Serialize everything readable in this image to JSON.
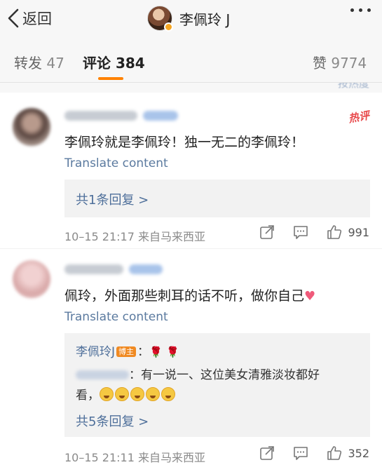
{
  "nav": {
    "back_label": "返回",
    "title": "李佩玲 J"
  },
  "tabs": [
    {
      "label": "转发",
      "count": "47"
    },
    {
      "label": "评论",
      "count": "384"
    },
    {
      "label": "赞",
      "count": "9774"
    }
  ],
  "comments": [
    {
      "hot_badge": "热评",
      "text": "李佩玲就是李佩玲！独一无二的李佩玲！",
      "translate": "Translate content",
      "reply_summary": "共1条回复 >",
      "time": "10–15 21:17",
      "location": "来自马来西亚",
      "likes": "991"
    },
    {
      "text": "佩玲，外面那些刺耳的话不听，做你自己",
      "translate": "Translate content",
      "reply": {
        "author": "李佩玲J",
        "author_tag": "博主",
        "line1_suffix": "：",
        "second_text": "：有一说一、这位美女清雅淡妆都好",
        "second_text_cont": "看，"
      },
      "reply_summary": "共5条回复 >",
      "time": "10–15 21:11",
      "location": "来自马来西亚",
      "likes": "352"
    }
  ],
  "colors": {
    "accent": "#ff8200",
    "link": "#4e6f9a",
    "hot": "#e8494b"
  }
}
